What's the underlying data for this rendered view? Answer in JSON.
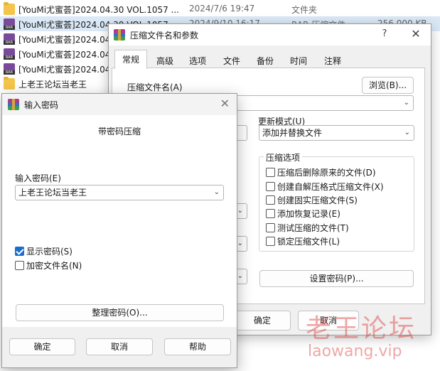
{
  "explorer": {
    "files": [
      {
        "name": "[YouMi尤蜜荟]2024.04.30 VOL.1057 ...",
        "date": "2024/7/6 19:47",
        "type": "文件夹",
        "size": "",
        "icon": "folder-icon",
        "selected": false
      },
      {
        "name": "[YouMi尤蜜荟]2024.04.30 VOL.1057 ...",
        "date": "2024/9/10 16:17",
        "type": "RAR 压缩文件",
        "size": "256,000 KB",
        "icon": "rar-file-icon",
        "selected": true
      },
      {
        "name": "[YouMi尤蜜荟]2024.04",
        "date": "",
        "type": "",
        "size": "",
        "icon": "rar-file-icon",
        "selected": false
      },
      {
        "name": "[YouMi尤蜜荟]2024.04",
        "date": "",
        "type": "",
        "size": "",
        "icon": "rar-file-icon",
        "selected": false
      },
      {
        "name": "[YouMi尤蜜荟]2024.04",
        "date": "",
        "type": "",
        "size": "",
        "icon": "rar-file-icon",
        "selected": false
      },
      {
        "name": "上老王论坛当老王",
        "date": "",
        "type": "",
        "size": "",
        "icon": "folder-icon",
        "selected": false
      }
    ]
  },
  "archive_dialog": {
    "title": "压缩文件名和参数",
    "help_glyph": "?",
    "close_glyph": "✕",
    "tabs": [
      "常规",
      "高级",
      "选项",
      "文件",
      "备份",
      "时间",
      "注释"
    ],
    "active_tab": "常规",
    "archive_name_label": "压缩文件名(A)",
    "browse_button": "浏览(B)...",
    "archive_name_value": "",
    "update_mode_label": "更新模式(U)",
    "update_mode_value": "添加并替换文件",
    "options_group_title": "压缩选项",
    "options": [
      {
        "label": "压缩后删除原来的文件(D)",
        "checked": false
      },
      {
        "label": "创建自解压格式压缩文件(X)",
        "checked": false
      },
      {
        "label": "创建固实压缩文件(S)",
        "checked": false
      },
      {
        "label": "添加恢复记录(E)",
        "checked": false
      },
      {
        "label": "测试压缩的文件(T)",
        "checked": false
      },
      {
        "label": "锁定压缩文件(L)",
        "checked": false
      }
    ],
    "set_password_button": "设置密码(P)...",
    "ok_button": "确定",
    "cancel_button": "取消"
  },
  "password_dialog": {
    "title": "输入密码",
    "close_glyph": "✕",
    "heading": "带密码压缩",
    "password_label": "输入密码(E)",
    "password_value": "上老王论坛当老王",
    "show_password_label": "显示密码(S)",
    "show_password_checked": true,
    "encrypt_names_label": "加密文件名(N)",
    "encrypt_names_checked": false,
    "organize_button": "整理密码(O)...",
    "ok_button": "确定",
    "cancel_button": "取消",
    "help_button": "帮助"
  },
  "watermark": {
    "text_cn": "老王论坛",
    "text_en": "laowang.vip"
  }
}
